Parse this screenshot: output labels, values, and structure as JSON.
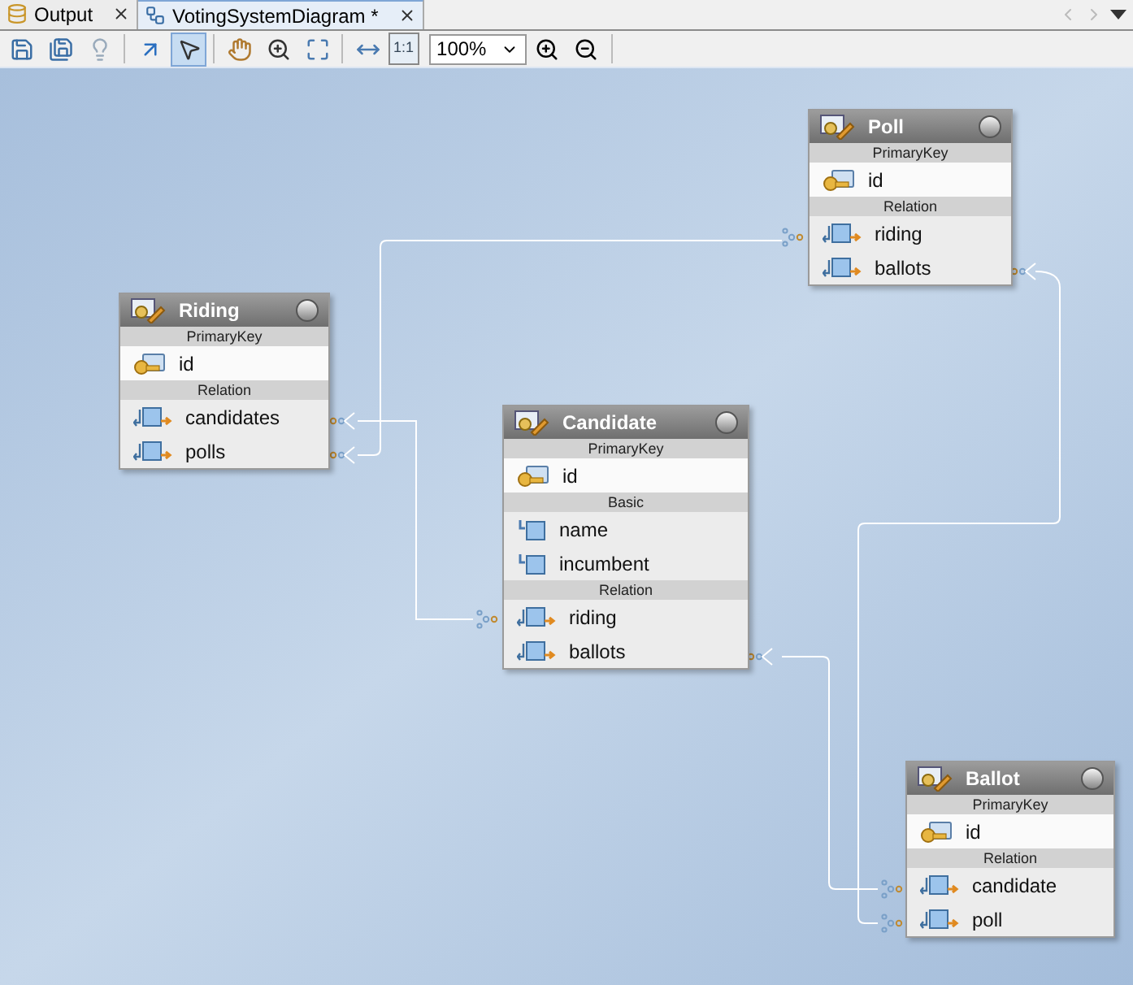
{
  "tabs": [
    {
      "label": "Output",
      "selected": false
    },
    {
      "label": "VotingSystemDiagram *",
      "selected": true
    }
  ],
  "toolbar": {
    "tools": [
      {
        "selected": false
      },
      {
        "selected": false
      },
      {
        "selected": false
      },
      {
        "selected": false
      },
      {
        "selected": true
      },
      {
        "selected": false
      },
      {
        "selected": false
      },
      {
        "selected": false
      },
      {
        "selected": false
      },
      {
        "label": "1:1",
        "selected": false
      }
    ],
    "zoom": "100%"
  },
  "entities": [
    {
      "name": "Riding",
      "sections": [
        {
          "title": "PrimaryKey",
          "fields": [
            {
              "name": "id",
              "kind": "key"
            }
          ]
        },
        {
          "title": "Relation",
          "fields": [
            {
              "name": "candidates",
              "kind": "relation"
            },
            {
              "name": "polls",
              "kind": "relation"
            }
          ]
        }
      ]
    },
    {
      "name": "Candidate",
      "sections": [
        {
          "title": "PrimaryKey",
          "fields": [
            {
              "name": "id",
              "kind": "key"
            }
          ]
        },
        {
          "title": "Basic",
          "fields": [
            {
              "name": "name",
              "kind": "basic"
            },
            {
              "name": "incumbent",
              "kind": "basic"
            }
          ]
        },
        {
          "title": "Relation",
          "fields": [
            {
              "name": "riding",
              "kind": "relation"
            },
            {
              "name": "ballots",
              "kind": "relation"
            }
          ]
        }
      ]
    },
    {
      "name": "Poll",
      "sections": [
        {
          "title": "PrimaryKey",
          "fields": [
            {
              "name": "id",
              "kind": "key"
            }
          ]
        },
        {
          "title": "Relation",
          "fields": [
            {
              "name": "riding",
              "kind": "relation"
            },
            {
              "name": "ballots",
              "kind": "relation"
            }
          ]
        }
      ]
    },
    {
      "name": "Ballot",
      "sections": [
        {
          "title": "PrimaryKey",
          "fields": [
            {
              "name": "id",
              "kind": "key"
            }
          ]
        },
        {
          "title": "Relation",
          "fields": [
            {
              "name": "candidate",
              "kind": "relation"
            },
            {
              "name": "poll",
              "kind": "relation"
            }
          ]
        }
      ]
    }
  ]
}
